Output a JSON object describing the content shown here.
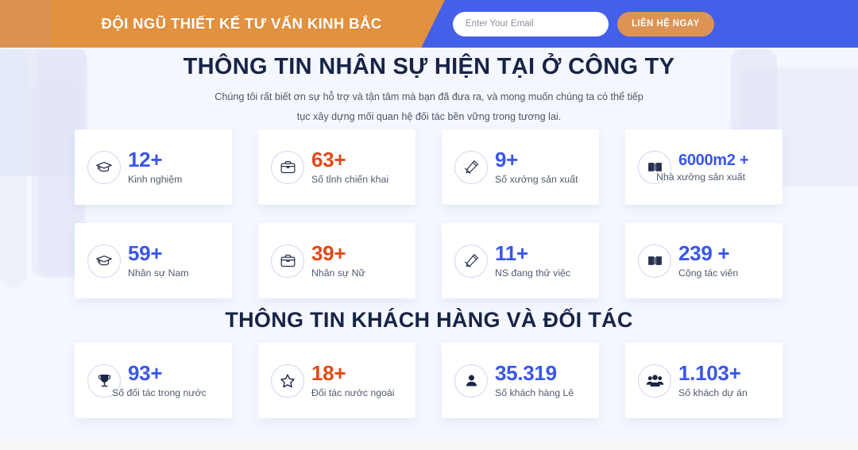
{
  "header": {
    "brand_title": "ĐỘI NGŨ THIẾT KẾ TƯ VẤN KINH BẮC",
    "email_placeholder": "Enter Your Email",
    "email_value": "",
    "cta_label": "LIÊN HỆ NGAY",
    "orange": "#e2913f",
    "blue": "#4560e8"
  },
  "section_one": {
    "title": "THÔNG TIN NHÂN SỰ HIỆN TẠI Ở CÔNG TY",
    "subtitle_line1": "Chúng tôi rất biết ơn sự hỗ trợ và tận tâm mà bạn đã đưa ra, và mong muốn chúng ta có thể tiếp",
    "subtitle_line2": "tục xây dựng mối quan hệ đối tác bền vững trong tương lai.",
    "row1": [
      {
        "icon": "graduation-cap-icon",
        "value": "12+",
        "label": "Kinh nghiệm",
        "color": "#3a57e8"
      },
      {
        "icon": "briefcase-icon",
        "value": "63+",
        "label": "Số tỉnh chiến khai",
        "color": "#e04a16"
      },
      {
        "icon": "ruler-pencil-icon",
        "value": "9+",
        "label": "Số xưởng sản xuất",
        "color": "#3a57e8"
      },
      {
        "icon": "open-book-icon",
        "value": "6000m2 +",
        "label": "Nhà xưởng sản xuất",
        "color": "#3a57e8"
      }
    ],
    "row2": [
      {
        "icon": "graduation-cap-icon",
        "value": "59+",
        "label": "Nhân sự Nam",
        "color": "#3a57e8"
      },
      {
        "icon": "briefcase-icon",
        "value": "39+",
        "label": "Nhân sự Nữ",
        "color": "#e04a16"
      },
      {
        "icon": "ruler-pencil-icon",
        "value": "11+",
        "label": "NS đang thử việc",
        "color": "#3a57e8"
      },
      {
        "icon": "open-book-icon",
        "value": "239 +",
        "label": "Cộng tác viên",
        "color": "#3a57e8"
      }
    ]
  },
  "section_two": {
    "title": "THÔNG TIN KHÁCH HÀNG VÀ ĐỐI TÁC",
    "row1": [
      {
        "icon": "trophy-icon",
        "value": "93+",
        "label": "Số đối tác trong nước",
        "color": "#3a57e8"
      },
      {
        "icon": "star-icon",
        "value": "18+",
        "label": "Đối tác nước ngoài",
        "color": "#e04a16"
      },
      {
        "icon": "person-icon",
        "value": "35.319",
        "label": "Số khách hàng Lẻ",
        "color": "#3a57e8"
      },
      {
        "icon": "people-group-icon",
        "value": "1.103+",
        "label": "Số khách dự án",
        "color": "#3a57e8"
      }
    ]
  }
}
